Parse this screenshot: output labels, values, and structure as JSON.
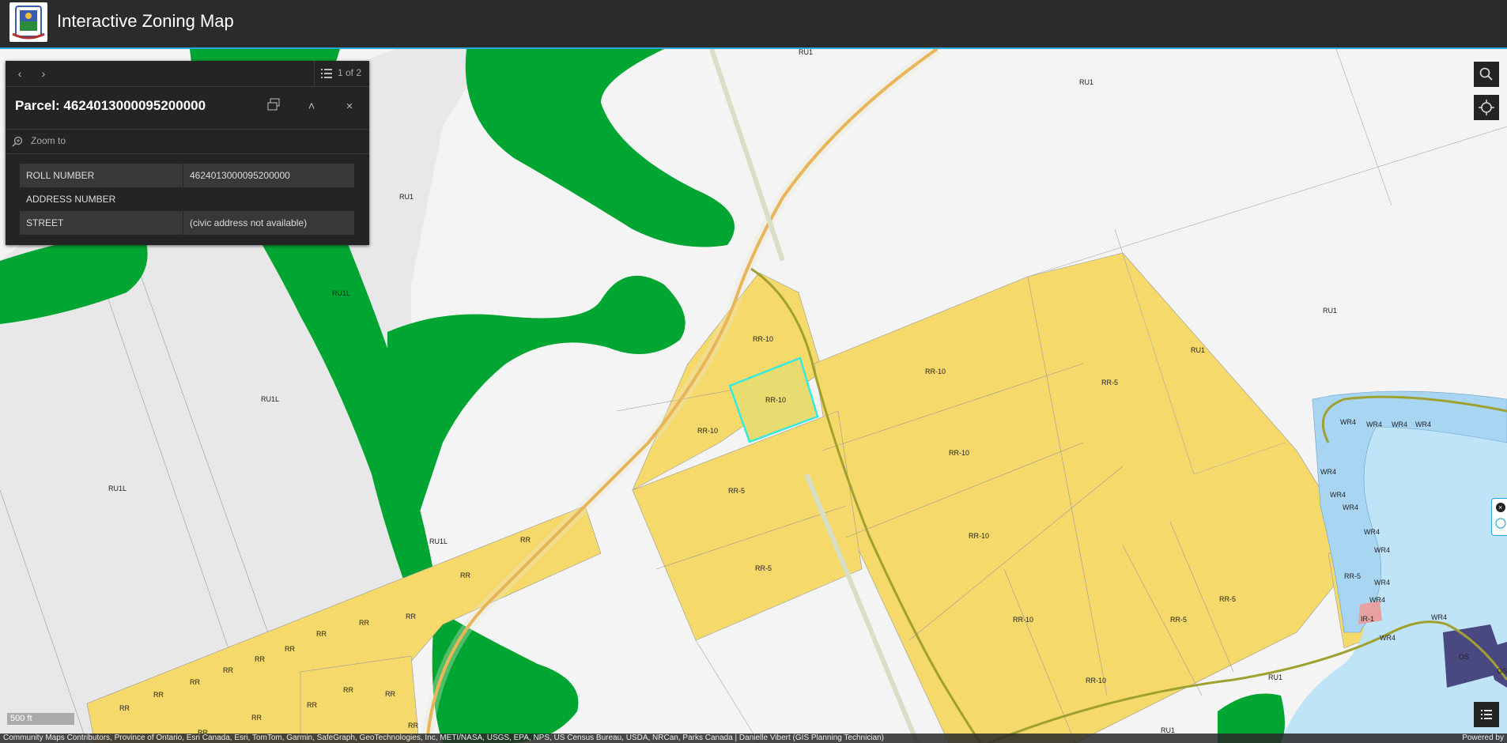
{
  "app": {
    "title": "Interactive Zoning Map"
  },
  "popup": {
    "title": "Parcel: 4624013000095200000",
    "page_count": "1 of 2",
    "zoom_to_label": "Zoom to",
    "attributes": [
      {
        "key": "ROLL NUMBER",
        "value": "4624013000095200000"
      },
      {
        "key": "ADDRESS NUMBER",
        "value": ""
      },
      {
        "key": "STREET",
        "value": "(civic address not available)"
      }
    ]
  },
  "map": {
    "scale_label": "500 ft",
    "attribution": "Community Maps Contributors, Province of Ontario, Esri Canada, Esri, TomTom, Garmin, SafeGraph, GeoTechnologies, Inc, METI/NASA, USGS, EPA, NPS, US Census Bureau, USDA, NRCan, Parks Canada | Danielle Vibert (GIS Planning Technician)",
    "powered_by": "Powered by",
    "zone_labels": {
      "ru1_top": "RU1",
      "ru1_a": "RU1",
      "ru1_b": "RU1",
      "ru1_c": "RU1",
      "ru1_d": "RU1",
      "ru1_e": "RU1",
      "ru1_f": "RU1",
      "ru1l_a": "RU1L",
      "ru1l_b": "RU1L",
      "ru1l_c": "RU1L",
      "ru1l_d": "RU1L",
      "rr10_a": "RR-10",
      "rr10_sel": "RR-10",
      "rr10_b": "RR-10",
      "rr10_c": "RR-10",
      "rr10_d": "RR-10",
      "rr10_e": "RR-10",
      "rr10_f": "RR-10",
      "rr10_g": "RR-10",
      "rr5_a": "RR-5",
      "rr5_b": "RR-5",
      "rr5_c": "RR-5",
      "rr5_d": "RR-5",
      "rr5_e": "RR-5",
      "rr5_f": "RR-5",
      "rr": "RR",
      "wr4": "WR4",
      "ir1": "IR-1",
      "os_a": "OS",
      "os_b": "OS"
    }
  },
  "colors": {
    "header_bg": "#2b2b2b",
    "accent": "#2aa7d6",
    "rural": "#f4f4f4",
    "green": "#00a532",
    "rr_yellow": "#f5d96b",
    "water": "#bfe4f7",
    "wr_blue": "#a8d5f2",
    "ir_pink": "#e8a0a0",
    "os_purple": "#4a4880",
    "road_orange": "#e89b1a",
    "road_olive": "#a0a030",
    "selection": "#35e8e0"
  },
  "icons": [
    "logo-crest",
    "chevron-left-icon",
    "chevron-right-icon",
    "page-list-icon",
    "dock-icon",
    "collapse-icon",
    "close-icon",
    "zoom-to-icon",
    "search-icon",
    "locate-icon",
    "legend-icon"
  ]
}
